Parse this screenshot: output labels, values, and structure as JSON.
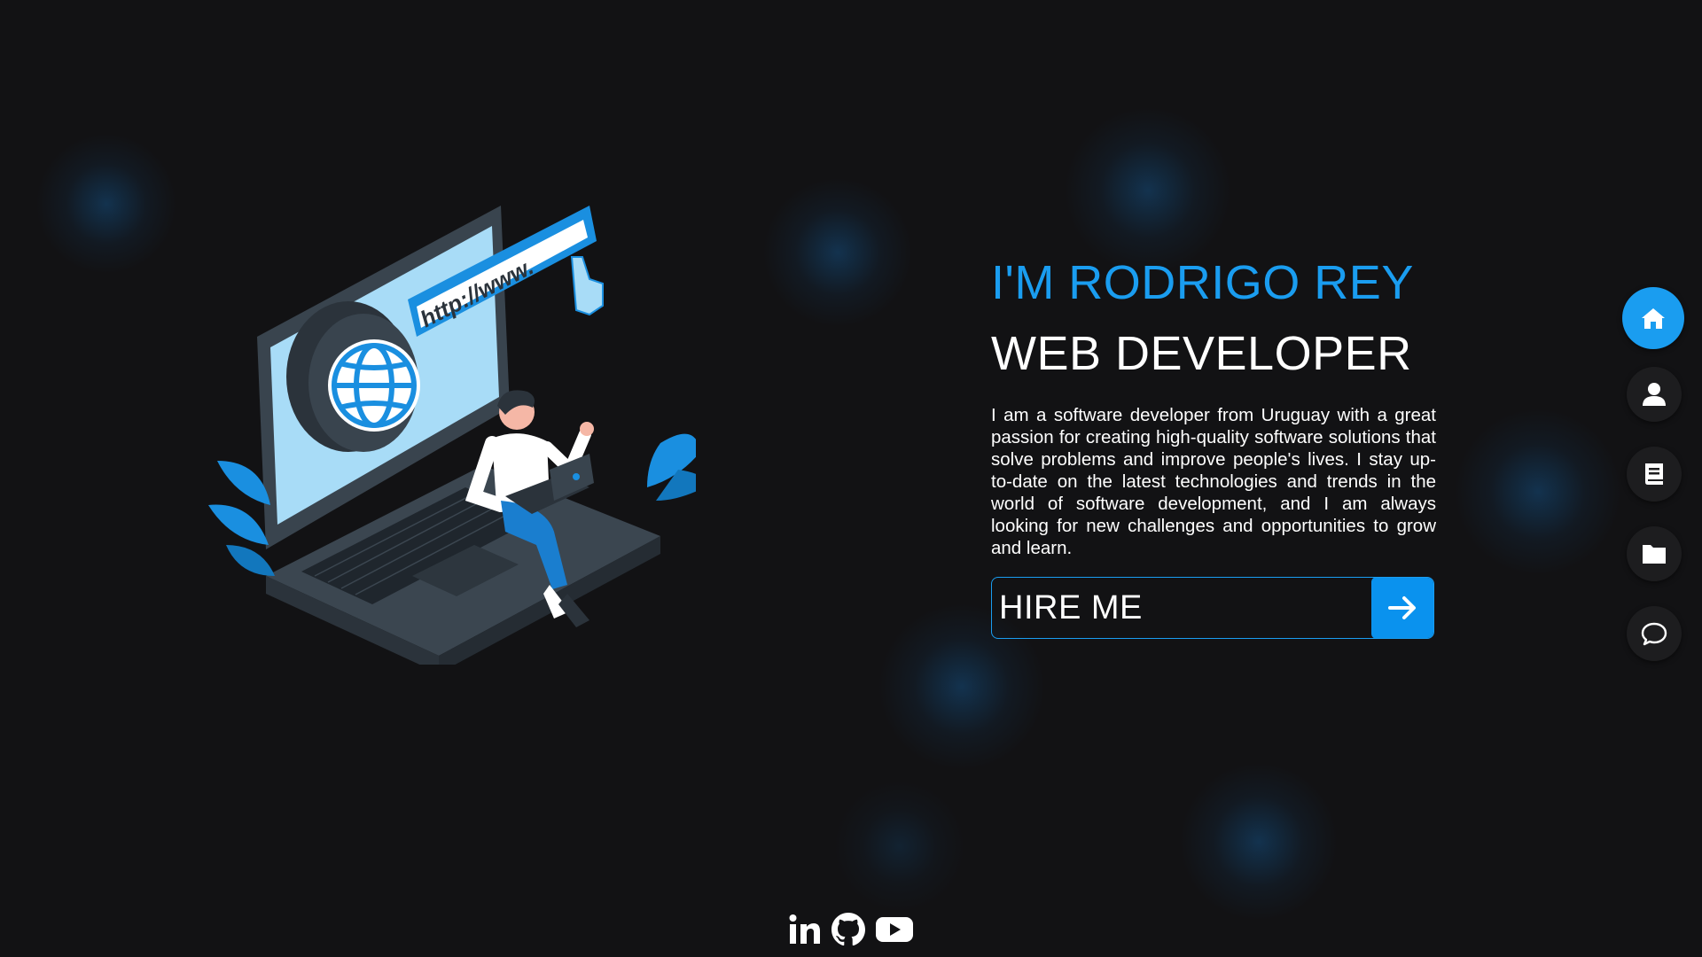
{
  "hero": {
    "greeting": "I'M RODRIGO REY",
    "role": "WEB DEVELOPER",
    "bio": "I am a software developer from Uruguay with a great passion for creating high-quality software solutions that solve problems and improve people's lives. I stay up-to-date on the latest technologies and trends in the world of software development, and I am always looking for new challenges and opportunities to grow and learn.",
    "cta_label": "HIRE ME"
  },
  "illustration": {
    "url_text": "http://www.",
    "icon": "laptop-developer-illustration"
  },
  "side_nav": [
    {
      "icon": "home-icon",
      "active": true
    },
    {
      "icon": "user-icon",
      "active": false
    },
    {
      "icon": "book-icon",
      "active": false
    },
    {
      "icon": "folder-icon",
      "active": false
    },
    {
      "icon": "chat-icon",
      "active": false
    }
  ],
  "socials": [
    {
      "icon": "linkedin-icon"
    },
    {
      "icon": "github-icon"
    },
    {
      "icon": "youtube-icon"
    }
  ],
  "colors": {
    "background": "#121214",
    "accent": "#1a9df0",
    "text": "#ffffff",
    "nav_button": "#1d1d1f"
  }
}
